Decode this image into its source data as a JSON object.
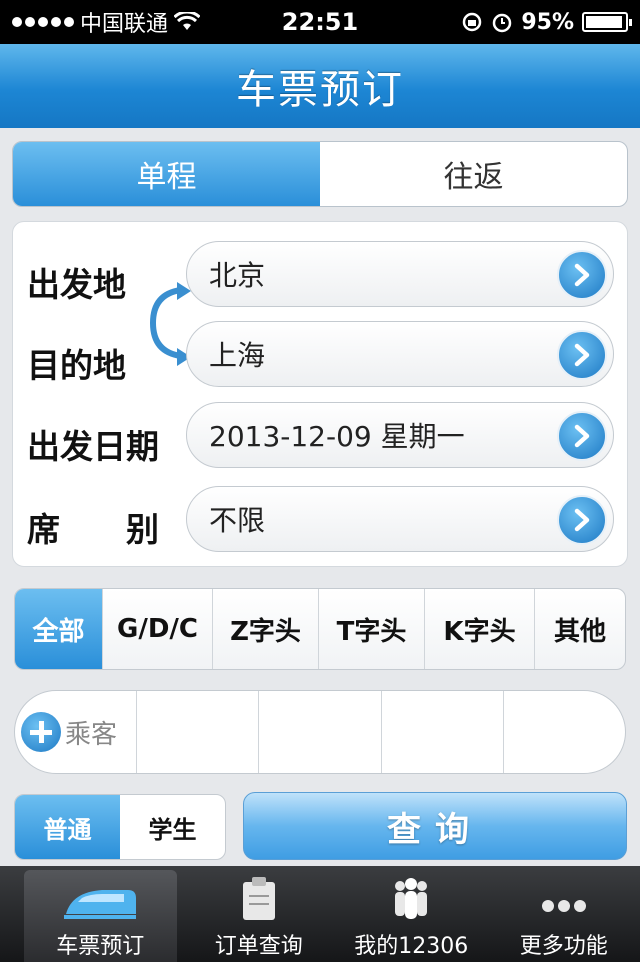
{
  "status_bar": {
    "carrier": "中国联通",
    "time": "22:51",
    "battery": "95%",
    "battery_level": 0.95
  },
  "header": {
    "title": "车票预订"
  },
  "trip_type": {
    "options": [
      "单程",
      "往返"
    ],
    "selected": "单程"
  },
  "form": {
    "from_label": "出发地",
    "from_value": "北京",
    "to_label": "目的地",
    "to_value": "上海",
    "date_label": "出发日期",
    "date_value": "2013-12-09 星期一",
    "seat_label_left": "席",
    "seat_label_right": "别",
    "seat_value": "不限"
  },
  "train_filter": {
    "options": [
      "全部",
      "G/D/C",
      "Z字头",
      "T字头",
      "K字头",
      "其他"
    ],
    "selected": "全部"
  },
  "passenger": {
    "add_label": "乘客"
  },
  "ticket_type": {
    "options": [
      "普通",
      "学生"
    ],
    "selected": "普通"
  },
  "query_button": {
    "label": "查询"
  },
  "tabbar": {
    "items": [
      {
        "label": "车票预订",
        "icon": "train-icon"
      },
      {
        "label": "订单查询",
        "icon": "clipboard-icon"
      },
      {
        "label": "我的12306",
        "icon": "people-icon"
      },
      {
        "label": "更多功能",
        "icon": "more-dots-icon"
      }
    ],
    "selected": "车票预订"
  },
  "colors": {
    "accent_blue": "#2a8fd9",
    "nav_blue": "#1d86d4",
    "tabbar_dark": "#151618"
  }
}
